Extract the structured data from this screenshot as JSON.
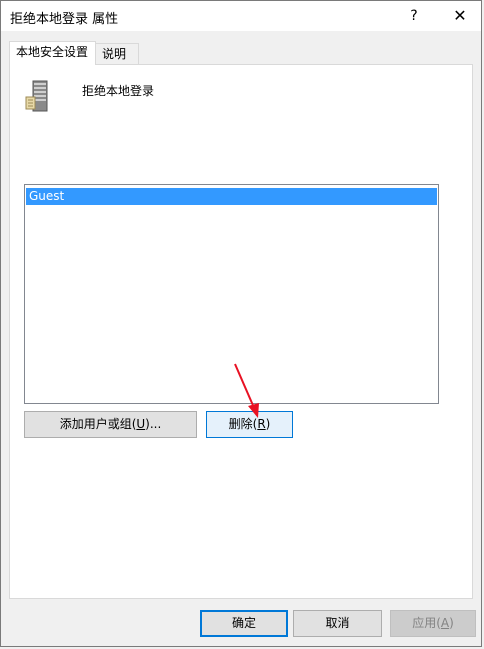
{
  "window": {
    "title": "拒绝本地登录 属性",
    "help_label": "?",
    "close_label": "✕"
  },
  "tabs": [
    {
      "label": "本地安全设置"
    },
    {
      "label": "说明"
    }
  ],
  "policy": {
    "icon": "server-icon",
    "name": "拒绝本地登录"
  },
  "list": {
    "items": [
      "Guest"
    ],
    "selected_index": 0
  },
  "buttons": {
    "add": {
      "text": "添加用户或组(",
      "mnemonic": "U",
      "suffix": ")..."
    },
    "remove": {
      "text": "删除(",
      "mnemonic": "R",
      "suffix": ")"
    },
    "ok": "确定",
    "cancel": "取消",
    "apply": {
      "text": "应用(",
      "mnemonic": "A",
      "suffix": ")"
    }
  },
  "colors": {
    "selection": "#3399ff",
    "focus_border": "#0078d7",
    "annotation_arrow": "#e81123"
  }
}
